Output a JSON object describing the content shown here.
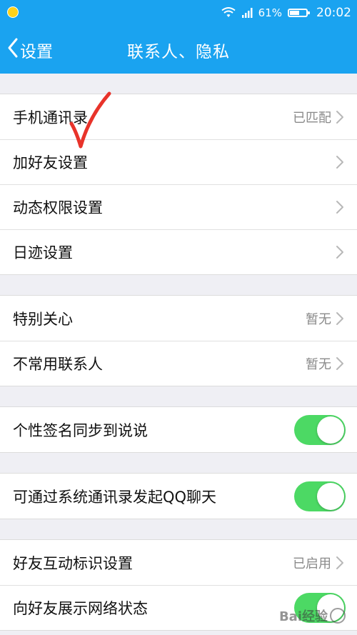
{
  "status_bar": {
    "battery_text": "61%",
    "battery_level": 0.61,
    "time": "20:02",
    "icons": [
      "notification-icon",
      "wifi-icon",
      "signal-icon",
      "battery-icon"
    ]
  },
  "navbar": {
    "back_label": "设置",
    "title": "联系人、隐私"
  },
  "groups": [
    {
      "rows": [
        {
          "label": "手机通讯录",
          "value": "已匹配",
          "type": "link"
        },
        {
          "label": "加好友设置",
          "value": "",
          "type": "link"
        },
        {
          "label": "动态权限设置",
          "value": "",
          "type": "link"
        },
        {
          "label": "日迹设置",
          "value": "",
          "type": "link"
        }
      ]
    },
    {
      "rows": [
        {
          "label": "特别关心",
          "value": "暂无",
          "type": "link"
        },
        {
          "label": "不常用联系人",
          "value": "暂无",
          "type": "link"
        }
      ]
    },
    {
      "rows": [
        {
          "label": "个性签名同步到说说",
          "value": "",
          "type": "toggle",
          "on": true
        }
      ]
    },
    {
      "rows": [
        {
          "label": "可通过系统通讯录发起QQ聊天",
          "value": "",
          "type": "toggle",
          "on": true
        }
      ]
    },
    {
      "rows": [
        {
          "label": "好友互动标识设置",
          "value": "已启用",
          "type": "link"
        },
        {
          "label": "向好友展示网络状态",
          "value": "",
          "type": "toggle",
          "on": true
        }
      ]
    }
  ],
  "watermark": "Bai经验",
  "colors": {
    "accent": "#1aa3f0",
    "toggle_on": "#4cd964",
    "annotation": "#e8332a",
    "background": "#efeff4"
  }
}
